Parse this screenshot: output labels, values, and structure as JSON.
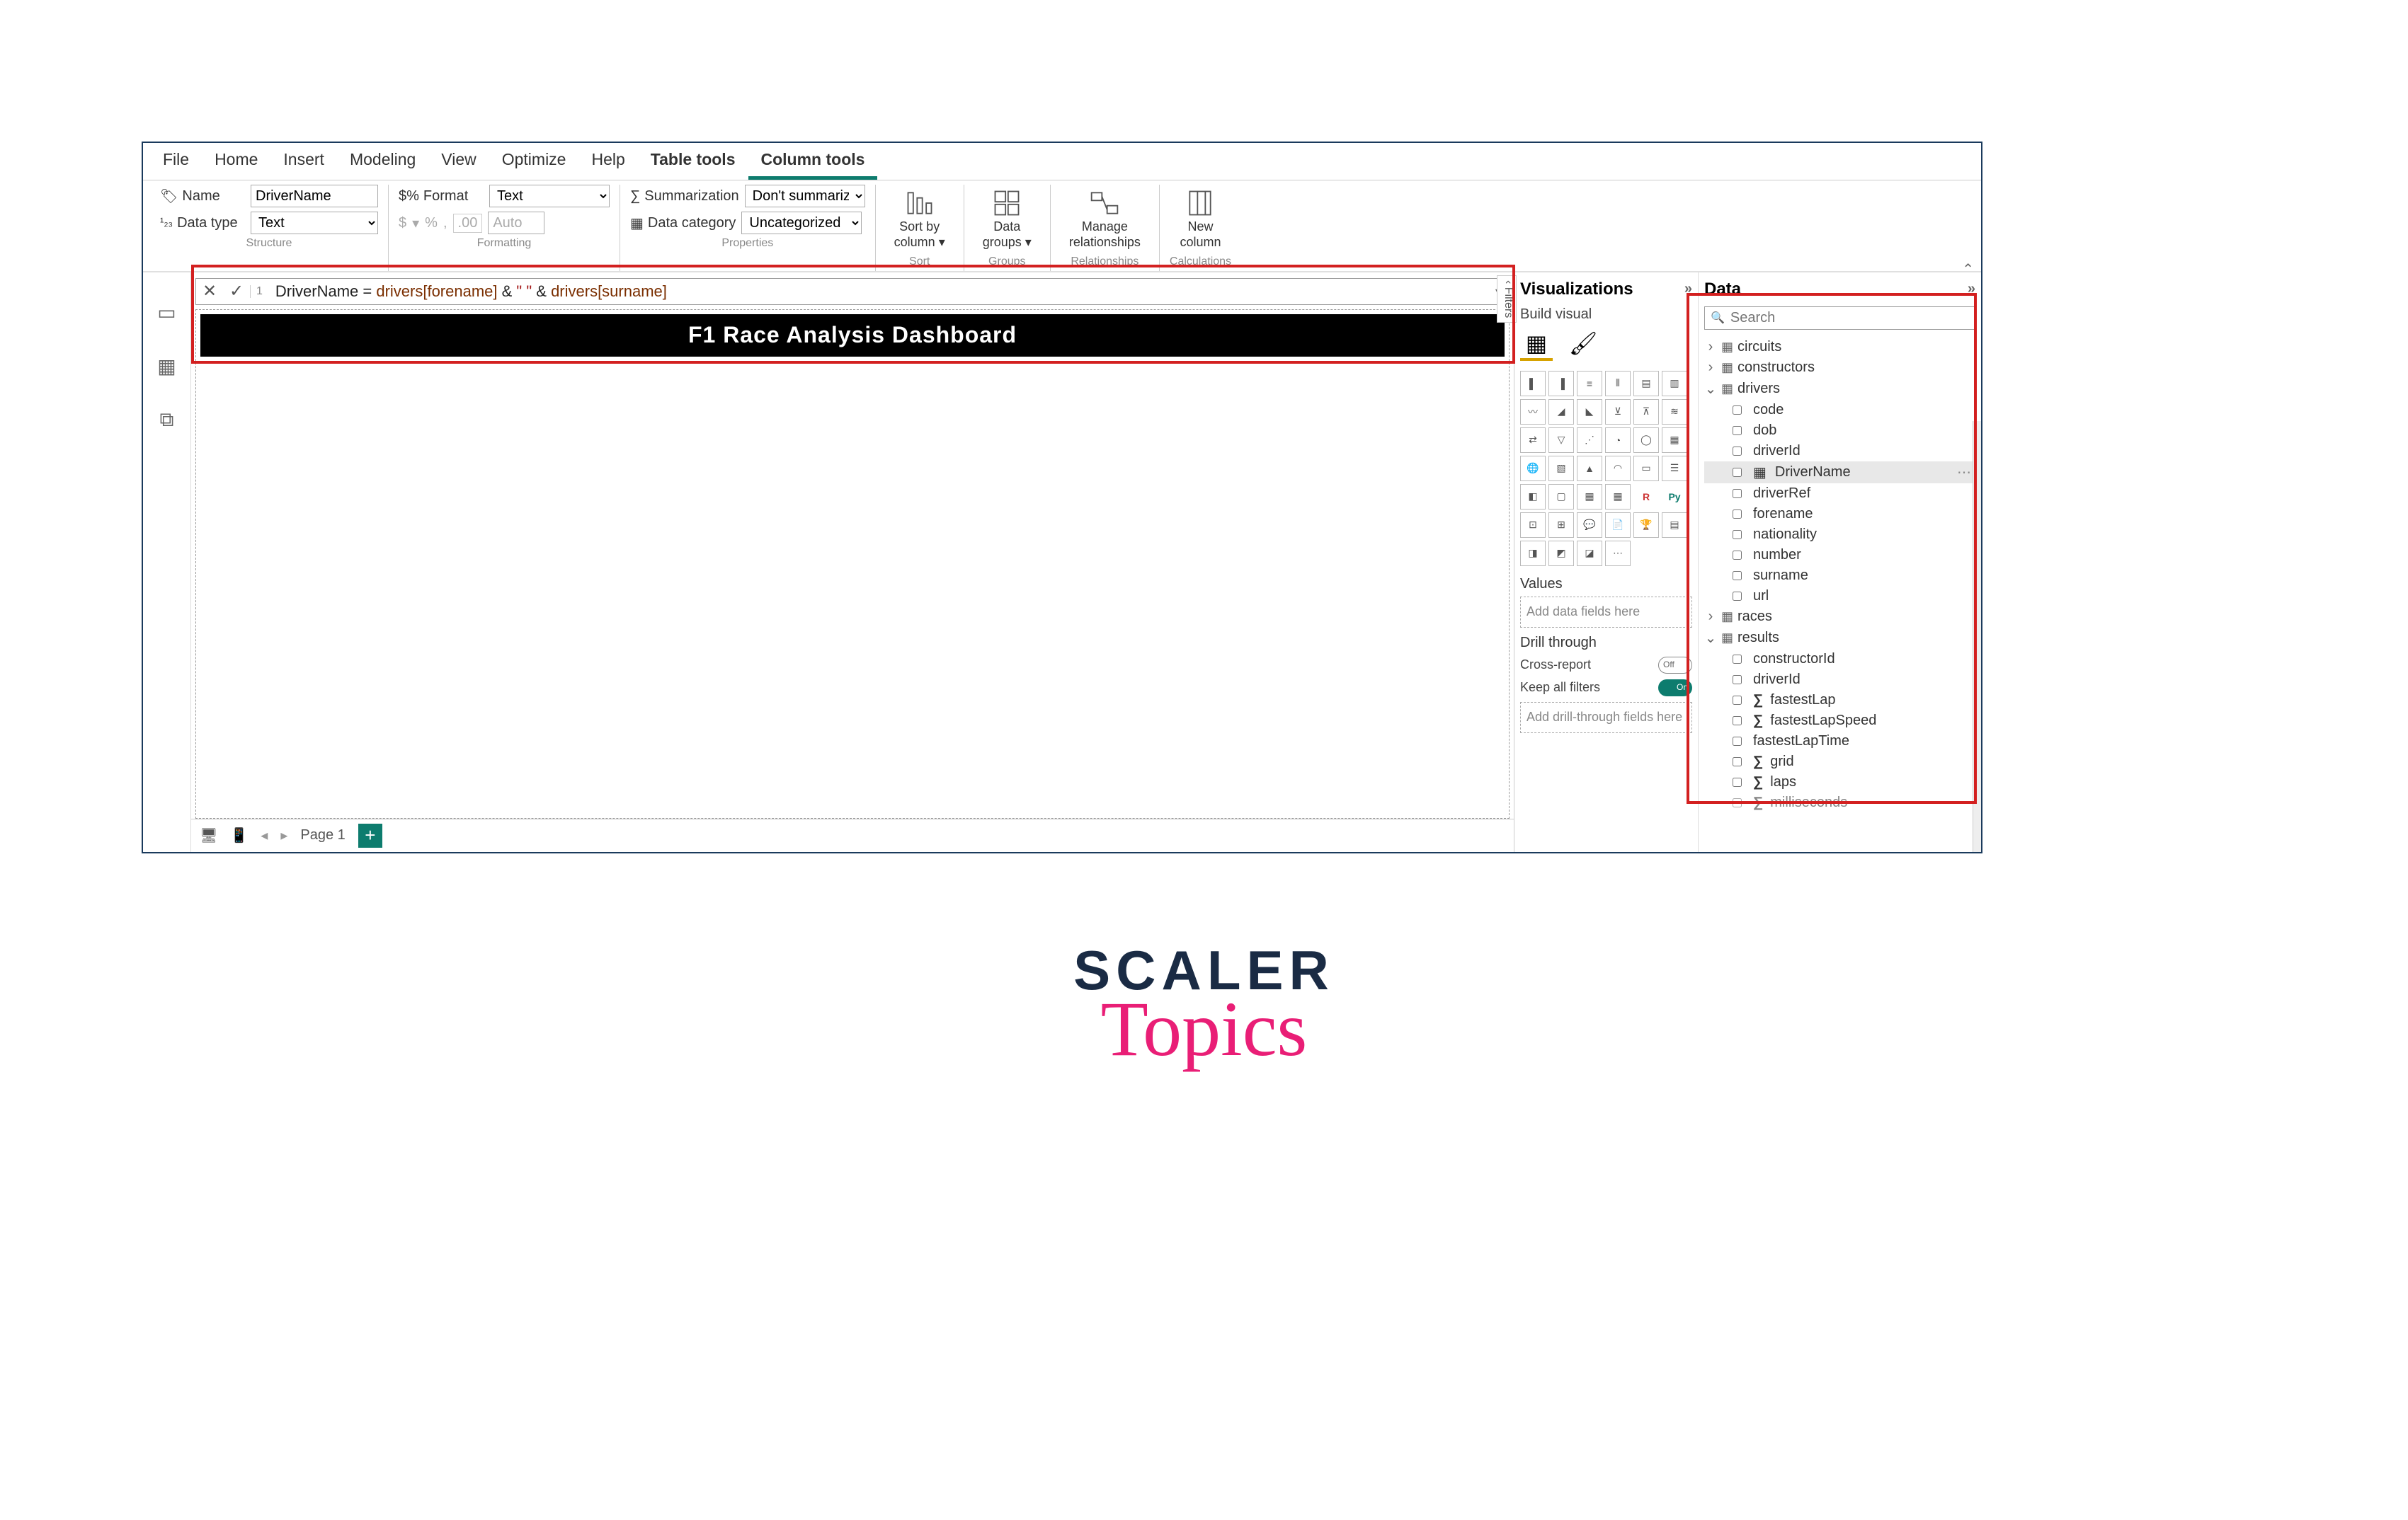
{
  "menu": [
    "File",
    "Home",
    "Insert",
    "Modeling",
    "View",
    "Optimize",
    "Help",
    "Table tools",
    "Column tools"
  ],
  "menu_active": 7,
  "menu_underline": 8,
  "ribbon": {
    "structure": {
      "name_label": "Name",
      "name_value": "DriverName",
      "datatype_label": "Data type",
      "datatype_value": "Text",
      "footer": "Structure"
    },
    "formatting": {
      "format_label": "Format",
      "format_value": "Text",
      "cur_sym": "$",
      "pct_sym": "%",
      "sep_sym": ",",
      "dec_label": "",
      "auto": "Auto",
      "footer": "Formatting"
    },
    "properties": {
      "sum_label": "Summarization",
      "sum_value": "Don't summarize",
      "cat_label": "Data category",
      "cat_value": "Uncategorized",
      "footer": "Properties"
    },
    "sort": {
      "label1": "Sort by",
      "label2": "column",
      "footer": "Sort"
    },
    "groups": {
      "label1": "Data",
      "label2": "groups",
      "footer": "Groups"
    },
    "rel": {
      "label1": "Manage",
      "label2": "relationships",
      "footer": "Relationships"
    },
    "calc": {
      "label1": "New",
      "label2": "column",
      "footer": "Calculations"
    }
  },
  "formula": {
    "lineno": "1",
    "text_plain": "DriverName = drivers[forename] & \" \" & drivers[surname]",
    "prefix": "DriverName = ",
    "col1": "drivers[forename]",
    "mid": " & ",
    "str": "\" \"",
    "mid2": " & ",
    "col2": "drivers[surname]"
  },
  "canvas_title": "F1 Race Analysis Dashboard",
  "filters_label": "Filters",
  "footer": {
    "page": "Page 1"
  },
  "viz": {
    "title": "Visualizations",
    "build": "Build visual",
    "values": "Values",
    "values_ph": "Add data fields here",
    "drill": "Drill through",
    "cross": "Cross-report",
    "keep": "Keep all filters",
    "drill_ph": "Add drill-through fields here"
  },
  "data": {
    "title": "Data",
    "search_ph": "Search",
    "tables": [
      {
        "name": "circuits",
        "open": false
      },
      {
        "name": "constructors",
        "open": false
      },
      {
        "name": "drivers",
        "open": true,
        "fields": [
          "code",
          "dob",
          "driverId",
          "DriverName",
          "driverRef",
          "forename",
          "nationality",
          "number",
          "surname",
          "url"
        ],
        "selected": "DriverName",
        "calc_field": "DriverName"
      },
      {
        "name": "races",
        "open": false
      },
      {
        "name": "results",
        "open": true,
        "fields_sigma": {
          "constructorId": false,
          "driverId": false,
          "fastestLap": true,
          "fastestLapSpeed": true,
          "fastestLapTime": false,
          "grid": true,
          "laps": true,
          "milliseconds": true
        }
      }
    ]
  },
  "logo": {
    "line1": "SCALER",
    "line2": "Topics"
  }
}
